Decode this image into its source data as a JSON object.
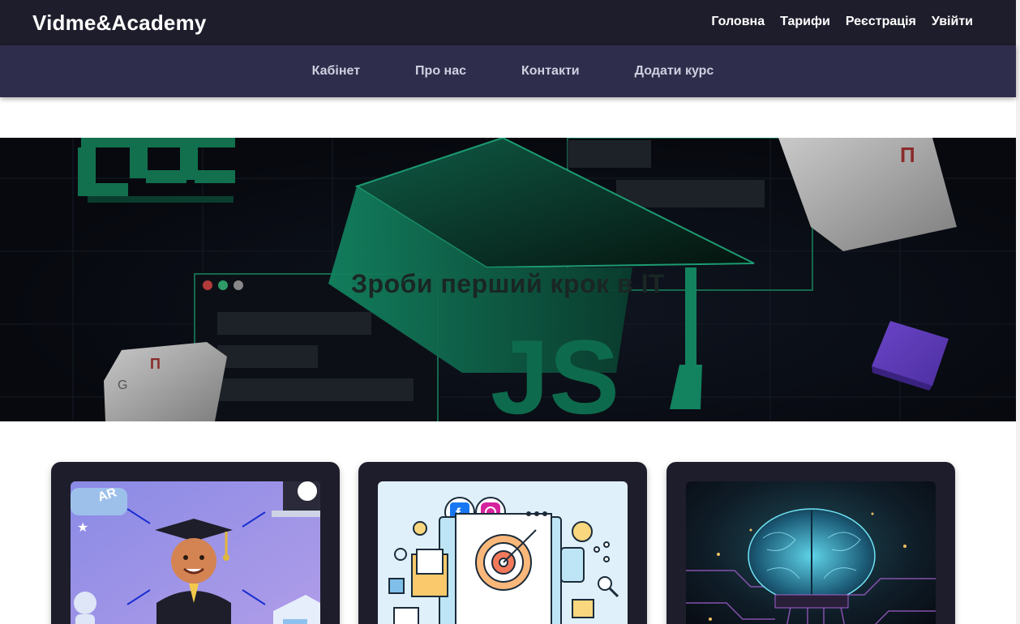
{
  "header": {
    "brand": "Vidme&Academy",
    "nav": [
      "Головна",
      "Тарифи",
      "Реєстрація",
      "Увійти"
    ]
  },
  "subnav": [
    "Кабінет",
    "Про нас",
    "Контакти",
    "Додати курс"
  ],
  "hero": {
    "title": "Зроби перший крок в IT",
    "decor_css": "CSS",
    "decor_js": "JS",
    "key_letters": [
      "П",
      "G",
      "П"
    ]
  },
  "cards": [
    {
      "image": "graduate-learning-illustration",
      "badge": "AR"
    },
    {
      "image": "digital-marketing-target-illustration"
    },
    {
      "image": "ai-brain-circuit-illustration"
    }
  ],
  "colors": {
    "topbar": "#1e1d2b",
    "subbar": "#2e2d4b",
    "accent_green": "#12825f",
    "card_bg": "#1e1d2b"
  }
}
